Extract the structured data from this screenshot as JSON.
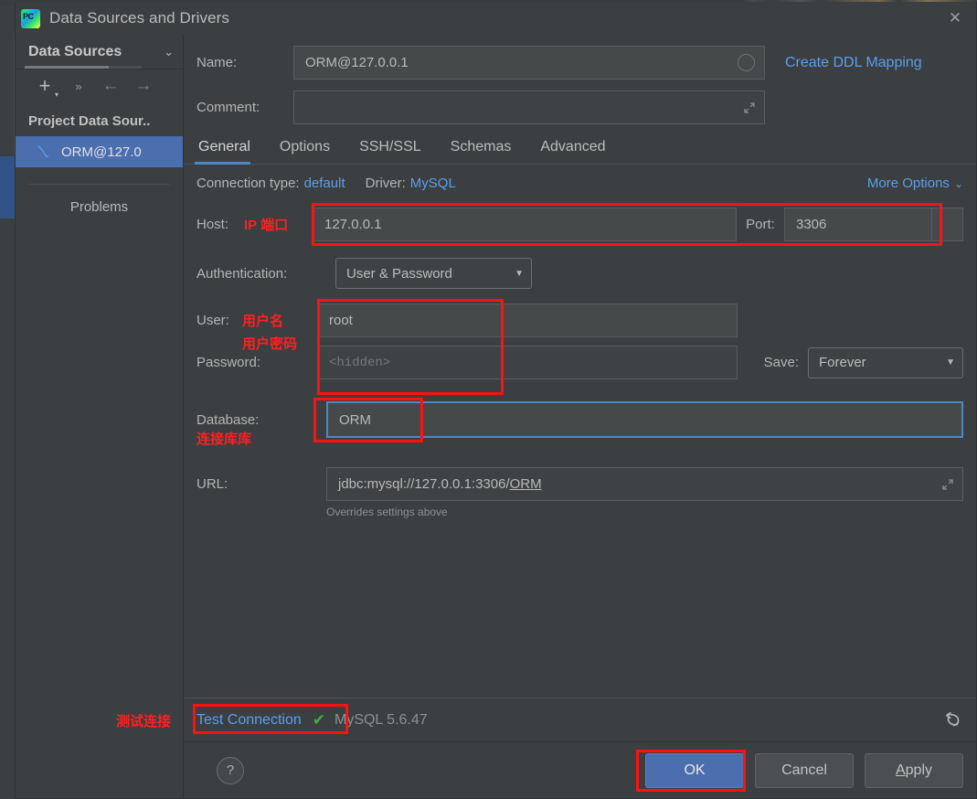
{
  "window": {
    "title": "Data Sources and Drivers",
    "app_icon": "pycharm-logo-icon",
    "close_icon": "✕"
  },
  "sidebar": {
    "dropdown_label": "Data Sources",
    "dropdown_icon": "chevron-down-icon",
    "toolbar": [
      {
        "name": "add-data-source-button",
        "glyph": "+"
      },
      {
        "name": "more-actions-button",
        "glyph": "»"
      },
      {
        "name": "navigate-back-button",
        "glyph": "←"
      },
      {
        "name": "navigate-forward-button",
        "glyph": "→"
      }
    ],
    "group_title": "Project Data Sour..",
    "items": [
      {
        "label": "ORM@127.0",
        "icon": "mysql-dolphin-icon",
        "selected": true
      }
    ],
    "problems_label": "Problems"
  },
  "form": {
    "name_label": "Name:",
    "name_value": "ORM@127.0.0.1",
    "name_spinner_icon": "loading-circle-icon",
    "create_ddl_label": "Create DDL Mapping",
    "comment_label": "Comment:",
    "comment_value": "",
    "comment_expand_icon": "expand-editor-icon"
  },
  "tabs": [
    {
      "label": "General",
      "active": true
    },
    {
      "label": "Options",
      "active": false
    },
    {
      "label": "SSH/SSL",
      "active": false
    },
    {
      "label": "Schemas",
      "active": false
    },
    {
      "label": "Advanced",
      "active": false
    }
  ],
  "settings": {
    "connection_type_label": "Connection type:",
    "connection_type_value": "default",
    "driver_label": "Driver:",
    "driver_value": "MySQL",
    "more_options_label": "More Options",
    "more_options_icon": "chevron-down-icon",
    "host_label": "Host:",
    "host_value": "127.0.0.1",
    "port_label": "Port:",
    "port_value": "3306",
    "auth_label": "Authentication:",
    "auth_value": "User & Password",
    "auth_caret_icon": "caret-down-icon",
    "user_label": "User:",
    "user_value": "root",
    "password_label": "Password:",
    "password_placeholder": "<hidden>",
    "save_label": "Save:",
    "save_value": "Forever",
    "save_caret_icon": "caret-down-icon",
    "database_label": "Database:",
    "database_value": "ORM",
    "url_label": "URL:",
    "url_prefix": "jdbc:mysql://127.0.0.1:3306/",
    "url_db": "ORM",
    "url_expand_icon": "expand-editor-icon",
    "url_hint": "Overrides settings above"
  },
  "annotations": {
    "host_port": "IP 端口",
    "user": "用户名",
    "password": "用户密码",
    "database": "连接库库",
    "test_connection": "测试连接",
    "color": "#ff1111"
  },
  "test_bar": {
    "test_connection_label": "Test Connection",
    "status_icon": "green-check-icon",
    "status_text": "MySQL 5.6.47",
    "revert_icon": "revert-arrow-icon"
  },
  "footer": {
    "help_label": "?",
    "help_icon": "help-question-icon",
    "ok_label": "OK",
    "cancel_label": "Cancel",
    "apply_label_first": "A",
    "apply_label_rest": "pply"
  },
  "colors": {
    "background": "#3c3f41",
    "accent_blue": "#4a88c7",
    "link_blue": "#5a9eed",
    "selection_blue": "#4b6eaf",
    "annotation_red": "#ff1111",
    "success_green": "#3fae3f"
  }
}
